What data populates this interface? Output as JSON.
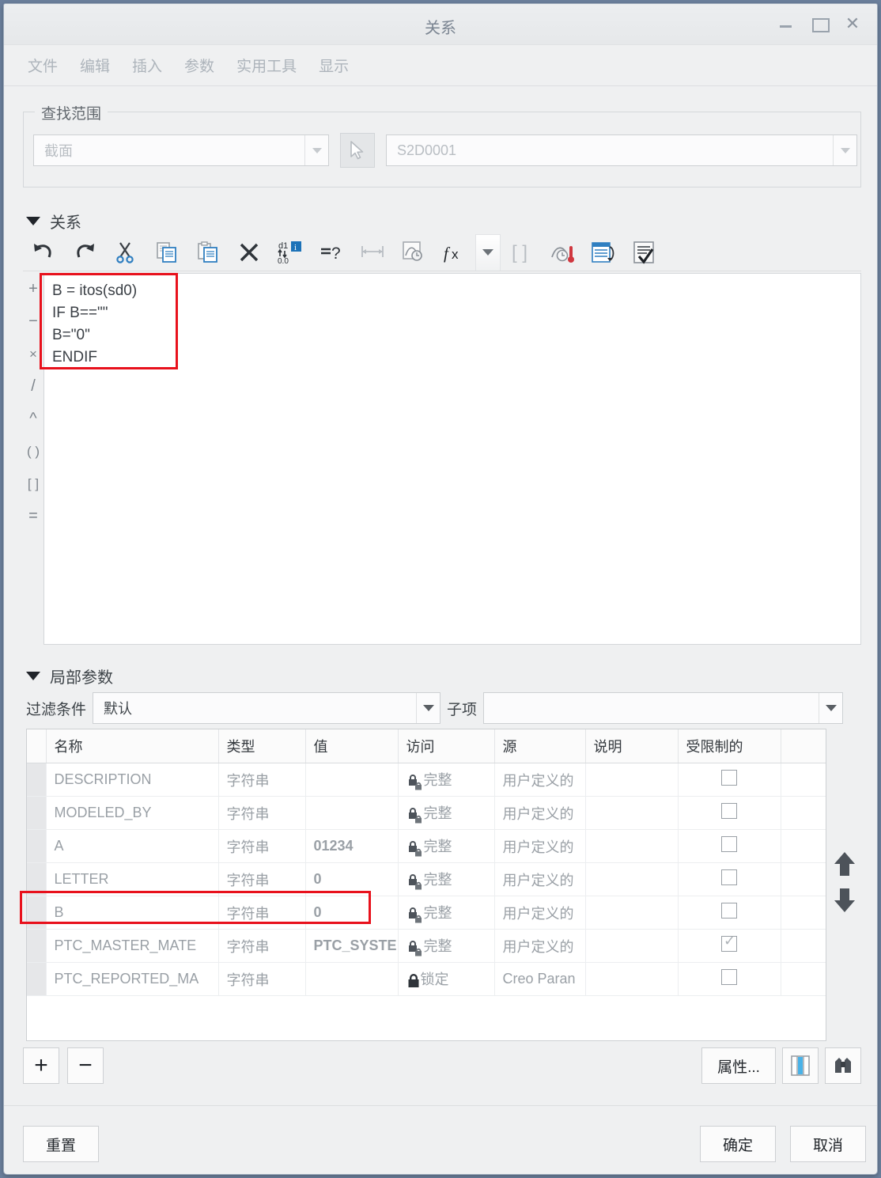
{
  "window": {
    "title": "关系",
    "controls": {
      "minimize": "minimize-icon",
      "maximize": "maximize-icon",
      "close": "✕"
    }
  },
  "menubar": {
    "items": [
      {
        "label": "文件"
      },
      {
        "label": "编辑"
      },
      {
        "label": "插入"
      },
      {
        "label": "参数"
      },
      {
        "label": "实用工具"
      },
      {
        "label": "显示"
      }
    ]
  },
  "scope": {
    "legend": "查找范围",
    "type_value": "截面",
    "pick_icon": "cursor-arrow-icon",
    "selection_value": "S2D0001"
  },
  "relations": {
    "heading": "关系",
    "toolbar": [
      {
        "name": "undo-icon",
        "title": "撤销"
      },
      {
        "name": "redo-icon",
        "title": "重做"
      },
      {
        "name": "cut-icon",
        "title": "剪切"
      },
      {
        "name": "copy-icon",
        "title": "复制"
      },
      {
        "name": "paste-icon",
        "title": "粘贴"
      },
      {
        "name": "delete-icon",
        "title": "删除"
      },
      {
        "name": "dimension-info-icon",
        "title": "切换尺寸"
      },
      {
        "name": "verify-icon",
        "title": "校验"
      },
      {
        "name": "dimension-arrow-icon",
        "title": "尺寸"
      },
      {
        "name": "sketch-units-icon",
        "title": "单位"
      },
      {
        "name": "function-icon",
        "title": "函数"
      },
      {
        "name": "function-dropdown-icon",
        "title": "函数列表"
      },
      {
        "name": "brackets-icon",
        "title": "括号"
      },
      {
        "name": "units-tool-icon",
        "title": "单位工具"
      },
      {
        "name": "params-table-icon",
        "title": "参数表"
      },
      {
        "name": "checklist-icon",
        "title": "检查"
      }
    ],
    "operators": [
      "+",
      "−",
      "×",
      "/",
      "^",
      "( )",
      "[ ]",
      "="
    ],
    "code": "B = itos(sd0)\nIF B==\"\"\nB=\"0\"\nENDIF",
    "highlight_color": "#e8111c"
  },
  "local_params": {
    "heading": "局部参数",
    "filter_label": "过滤条件",
    "filter_value": "默认",
    "child_label": "子项",
    "child_value": "",
    "columns": [
      "名称",
      "类型",
      "值",
      "访问",
      "源",
      "说明",
      "受限制的"
    ],
    "rows": [
      {
        "name": "DESCRIPTION",
        "type": "字符串",
        "value": "",
        "access": "完整",
        "access_icon": "lock-partial-icon",
        "source": "用户定义的",
        "desc": "",
        "restricted": false
      },
      {
        "name": "MODELED_BY",
        "type": "字符串",
        "value": "",
        "access": "完整",
        "access_icon": "lock-partial-icon",
        "source": "用户定义的",
        "desc": "",
        "restricted": false
      },
      {
        "name": "A",
        "type": "字符串",
        "value": "01234",
        "access": "完整",
        "access_icon": "lock-partial-icon",
        "source": "用户定义的",
        "desc": "",
        "restricted": false
      },
      {
        "name": "LETTER",
        "type": "字符串",
        "value": "0",
        "access": "完整",
        "access_icon": "lock-partial-icon",
        "source": "用户定义的",
        "desc": "",
        "restricted": false
      },
      {
        "name": "B",
        "type": "字符串",
        "value": "0",
        "access": "完整",
        "access_icon": "lock-partial-icon",
        "source": "用户定义的",
        "desc": "",
        "restricted": false
      },
      {
        "name": "PTC_MASTER_MATE",
        "type": "字符串",
        "value": "PTC_SYSTE",
        "access": "完整",
        "access_icon": "lock-partial-icon",
        "source": "用户定义的",
        "desc": "",
        "restricted": true
      },
      {
        "name": "PTC_REPORTED_MA",
        "type": "字符串",
        "value": "",
        "access": "锁定",
        "access_icon": "lock-closed-icon",
        "source": "Creo Paran",
        "desc": "",
        "restricted": false
      }
    ],
    "highlighted_row": "B",
    "move_up_icon": "arrow-up-icon",
    "move_down_icon": "arrow-down-icon",
    "add_label": "+",
    "remove_label": "−",
    "properties_label": "属性...",
    "columns_icon": "column-settings-icon",
    "find_icon": "binoculars-icon"
  },
  "footer": {
    "reset_label": "重置",
    "ok_label": "确定",
    "cancel_label": "取消"
  }
}
